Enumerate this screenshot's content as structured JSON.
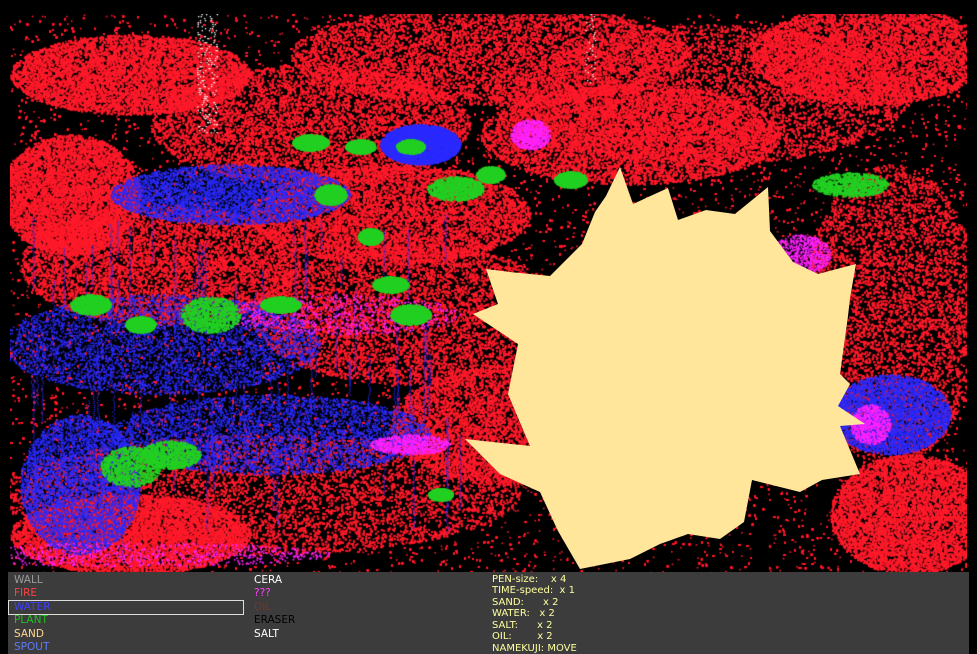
{
  "colors": {
    "fire": "#ff1a2a",
    "water": "#2a2aff",
    "plant": "#22d022",
    "sand": "#ffe69a",
    "magenta": "#ff22ff",
    "panel": "#3c3c3c",
    "stats_text": "#ffffa0"
  },
  "elements_left": [
    {
      "label": "WALL",
      "color": "#9c9c9c",
      "selected": false
    },
    {
      "label": "FIRE",
      "color": "#ff4040",
      "selected": false
    },
    {
      "label": "WATER",
      "color": "#4040ff",
      "selected": true
    },
    {
      "label": "PLANT",
      "color": "#20c020",
      "selected": false
    },
    {
      "label": "SAND",
      "color": "#ffd890",
      "selected": false
    },
    {
      "label": "SPOUT",
      "color": "#5a7cff",
      "selected": false
    }
  ],
  "elements_right": [
    {
      "label": "CERA",
      "color": "#ffffff",
      "selected": false
    },
    {
      "label": "???",
      "color": "#ff40ff",
      "selected": false
    },
    {
      "label": "OIL",
      "color": "#6a3a30",
      "selected": false
    },
    {
      "label": "ERASER",
      "color": "#000000",
      "selected": false
    },
    {
      "label": "SALT",
      "color": "#ffffff",
      "selected": false
    }
  ],
  "stats": [
    "PEN-size:    x 4",
    "TIME-speed:  x 1",
    "SAND:      x 2",
    "WATER:   x 2",
    "SALT:      x 2",
    "OIL:        x 2",
    "NAMEKUJI: MOVE"
  ]
}
